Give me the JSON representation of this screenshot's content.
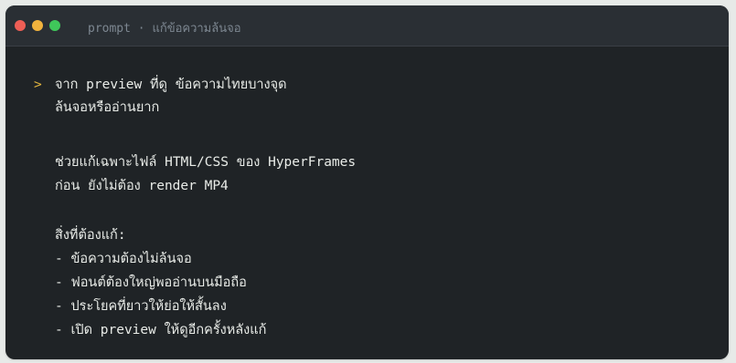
{
  "window": {
    "title": "prompt · แก้ข้อความล้นจอ",
    "colors": {
      "close": "#ee5e55",
      "minimize": "#f2b33d",
      "maximize": "#3fc75a",
      "prompt_marker": "#e2b53e",
      "background": "#1f2326",
      "titlebar": "#2a2f34"
    }
  },
  "prompt": {
    "marker": ">",
    "lines": [
      "จาก preview ที่ดู ข้อความไทยบางจุด",
      "ล้นจอหรืออ่านยาก",
      "ช่วยแก้เฉพาะไฟล์ HTML/CSS ของ HyperFrames",
      "ก่อน ยังไม่ต้อง render MP4",
      "สิ่งที่ต้องแก้:",
      "- ข้อความต้องไม่ล้นจอ",
      "- ฟอนต์ต้องใหญ่พออ่านบนมือถือ",
      "- ประโยคที่ยาวให้ย่อให้สั้นลง",
      "- เปิด preview ให้ดูอีกครั้งหลังแก้"
    ]
  }
}
